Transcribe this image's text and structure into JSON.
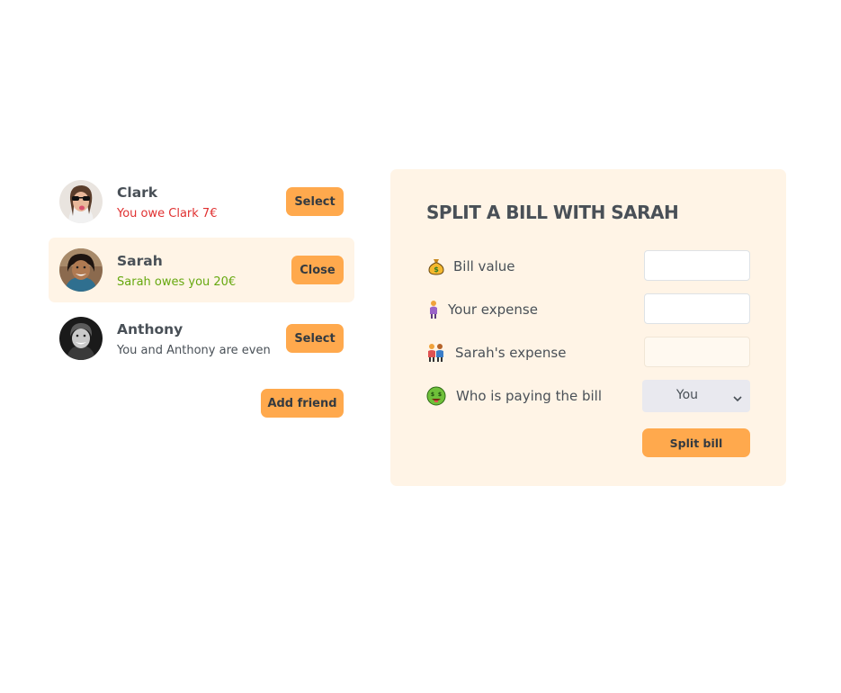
{
  "friends": [
    {
      "name": "Clark",
      "status": "You owe Clark 7€",
      "status_tone": "negative",
      "button": "Select",
      "selected": false
    },
    {
      "name": "Sarah",
      "status": "Sarah owes you 20€",
      "status_tone": "positive",
      "button": "Close",
      "selected": true
    },
    {
      "name": "Anthony",
      "status": "You and Anthony are even",
      "status_tone": "neutral",
      "button": "Select",
      "selected": false
    }
  ],
  "add_friend_label": "Add friend",
  "split_form": {
    "title": "SPLIT A BILL WITH SARAH",
    "bill_value_label": "Bill value",
    "bill_value": "",
    "your_expense_label": "Your expense",
    "your_expense": "",
    "friend_expense_label": "Sarah's expense",
    "friend_expense": "",
    "payer_label": "Who is paying the bill",
    "payer_selected": "You",
    "submit_label": "Split bill"
  },
  "colors": {
    "accent": "#ffa94d",
    "panel_bg": "#fff4e6",
    "negative": "#e03131",
    "positive": "#66a80f",
    "text": "#495057"
  },
  "icons": [
    "money-bag-icon",
    "person-icon",
    "two-people-icon",
    "money-face-icon",
    "chevron-down-icon"
  ]
}
